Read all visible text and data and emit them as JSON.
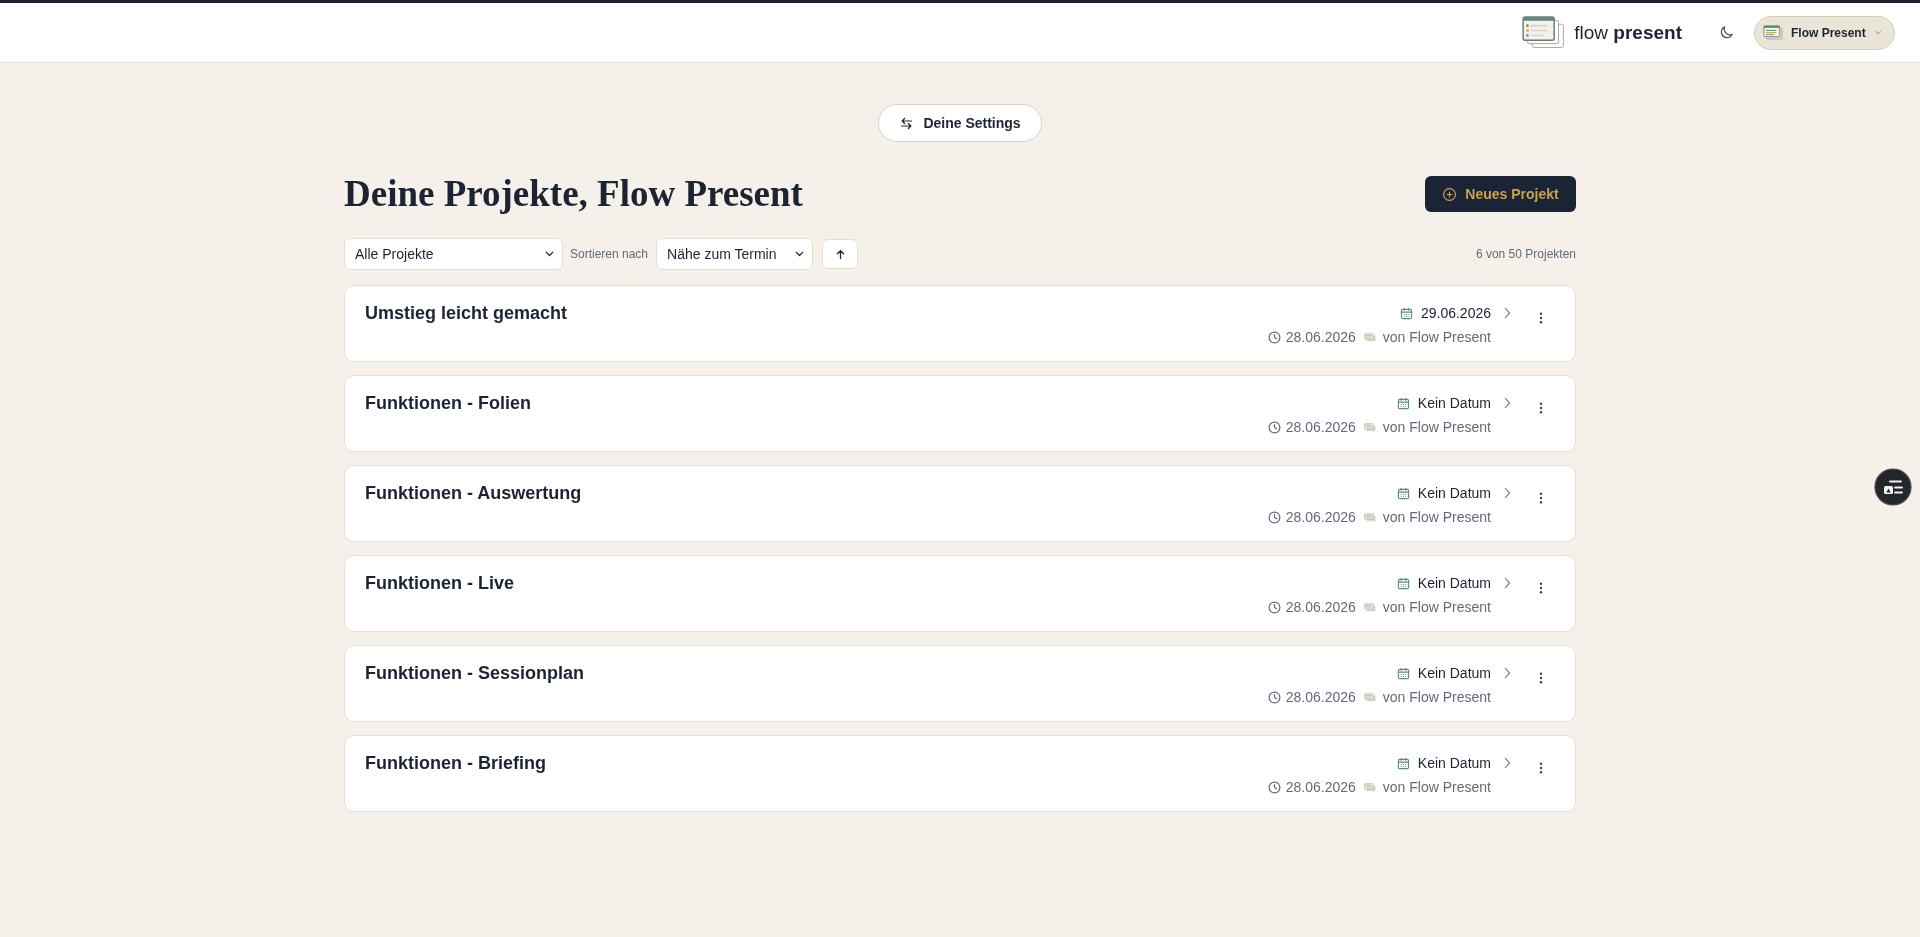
{
  "header": {
    "brand": "flow **present**",
    "user_menu": {
      "name": "Flow Present"
    }
  },
  "settings_button": {
    "label": "Deine Settings"
  },
  "heading": "Deine Projekte, Flow Present",
  "new_project_button": {
    "label": "Neues Projekt"
  },
  "filters": {
    "project_filter": {
      "value": "Alle Projekte"
    },
    "sort_label": "Sortieren nach",
    "sort_by": {
      "value": "Nähe zum Termin"
    }
  },
  "project_count": "6 von 50 Projekten",
  "projects": [
    {
      "title": "Umstieg leicht gemacht",
      "due": "29.06.2026",
      "created": "28.06.2026",
      "owner": "von Flow Present"
    },
    {
      "title": "Funktionen - Folien",
      "due": "Kein Datum",
      "created": "28.06.2026",
      "owner": "von Flow Present"
    },
    {
      "title": "Funktionen - Auswertung",
      "due": "Kein Datum",
      "created": "28.06.2026",
      "owner": "von Flow Present"
    },
    {
      "title": "Funktionen - Live",
      "due": "Kein Datum",
      "created": "28.06.2026",
      "owner": "von Flow Present"
    },
    {
      "title": "Funktionen - Sessionplan",
      "due": "Kein Datum",
      "created": "28.06.2026",
      "owner": "von Flow Present"
    },
    {
      "title": "Funktionen - Briefing",
      "due": "Kein Datum",
      "created": "28.06.2026",
      "owner": "von Flow Present"
    }
  ]
}
